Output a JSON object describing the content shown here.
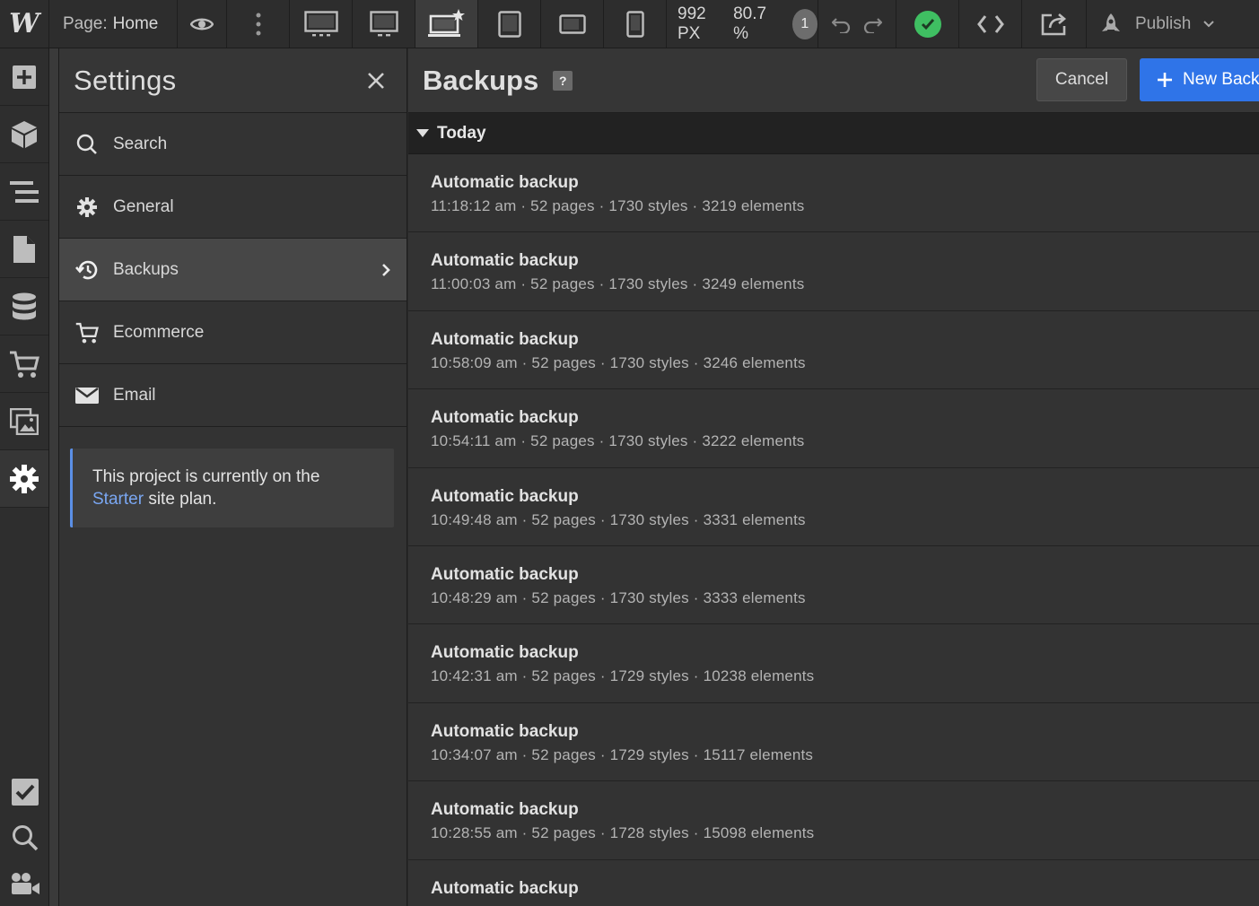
{
  "topbar": {
    "logo": "W",
    "page_key": "Page:",
    "page_name": "Home",
    "width_px": "992 PX",
    "zoom": "80.7 %",
    "badge": "1",
    "publish": "Publish"
  },
  "settings": {
    "title": "Settings",
    "items": [
      {
        "label": "Search",
        "icon": "search-icon"
      },
      {
        "label": "General",
        "icon": "gear-icon"
      },
      {
        "label": "Backups",
        "icon": "history-icon"
      },
      {
        "label": "Ecommerce",
        "icon": "cart-icon"
      },
      {
        "label": "Email",
        "icon": "envelope-icon"
      }
    ],
    "plan_note": {
      "prefix": "This project is currently on the",
      "plan": "Starter",
      "suffix": "site plan."
    }
  },
  "backups": {
    "title": "Backups",
    "help": "?",
    "cancel": "Cancel",
    "new_backup": "New Backup",
    "group": "Today",
    "rows": [
      {
        "title": "Automatic backup",
        "meta": "11:18:12 am · 52 pages · 1730 styles · 3219 elements"
      },
      {
        "title": "Automatic backup",
        "meta": "11:00:03 am · 52 pages · 1730 styles · 3249 elements"
      },
      {
        "title": "Automatic backup",
        "meta": "10:58:09 am · 52 pages · 1730 styles · 3246 elements"
      },
      {
        "title": "Automatic backup",
        "meta": "10:54:11 am · 52 pages · 1730 styles · 3222 elements"
      },
      {
        "title": "Automatic backup",
        "meta": "10:49:48 am · 52 pages · 1730 styles · 3331 elements"
      },
      {
        "title": "Automatic backup",
        "meta": "10:48:29 am · 52 pages · 1730 styles · 3333 elements"
      },
      {
        "title": "Automatic backup",
        "meta": "10:42:31 am · 52 pages · 1729 styles · 10238 elements"
      },
      {
        "title": "Automatic backup",
        "meta": "10:34:07 am · 52 pages · 1729 styles · 15117 elements"
      },
      {
        "title": "Automatic backup",
        "meta": "10:28:55 am · 52 pages · 1728 styles · 15098 elements"
      },
      {
        "title": "Automatic backup",
        "meta": ""
      }
    ]
  },
  "colors": {
    "accent": "#2f74e8",
    "success": "#3fbf62",
    "link": "#7aa7f2"
  }
}
